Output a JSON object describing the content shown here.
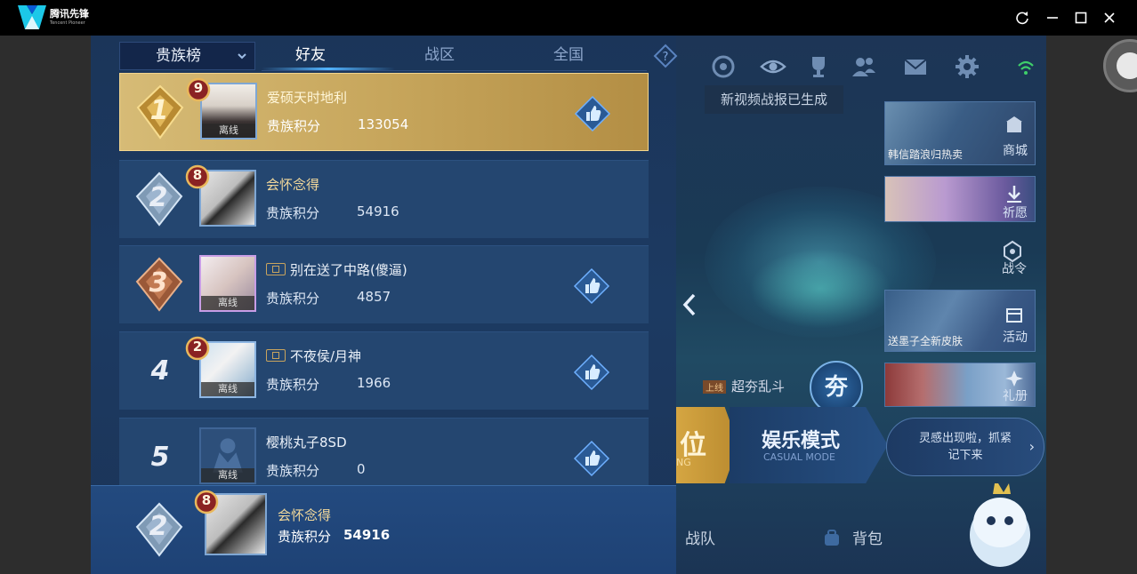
{
  "window": {
    "app_name": "腾讯先锋",
    "app_subtitle": "Tencent Pioneer",
    "controls": [
      "refresh-icon",
      "minimize-icon",
      "maximize-icon",
      "close-icon"
    ]
  },
  "leaderboard": {
    "dropdown_label": "贵族榜",
    "tabs": [
      {
        "label": "好友",
        "active": true
      },
      {
        "label": "战区",
        "active": false
      },
      {
        "label": "全国",
        "active": false
      }
    ],
    "score_label": "贵族积分",
    "rows": [
      {
        "rank": "1",
        "noble_level": "9",
        "name": "爱硕天时地利",
        "score": "133054",
        "status": "离线",
        "has_like": true,
        "has_badge": false
      },
      {
        "rank": "2",
        "noble_level": "8",
        "name": "会怀念得",
        "score": "54916",
        "status": "",
        "has_like": false,
        "has_badge": false
      },
      {
        "rank": "3",
        "noble_level": "",
        "name": "别在送了中路(傻逼)",
        "score": "4857",
        "status": "离线",
        "has_like": true,
        "has_badge": true
      },
      {
        "rank": "4",
        "noble_level": "2",
        "name": "不夜侯/月神",
        "score": "1966",
        "status": "离线",
        "has_like": true,
        "has_badge": true
      },
      {
        "rank": "5",
        "noble_level": "",
        "name": "樱桃丸子8SD",
        "score": "0",
        "status": "离线",
        "has_like": true,
        "has_badge": false
      }
    ],
    "mine": {
      "rank": "2",
      "noble_level": "8",
      "name": "会怀念得",
      "score_label": "贵族积分",
      "score": "54916"
    }
  },
  "game_ui": {
    "video_tip": "新视频战报已生成",
    "side_cards": [
      {
        "label": "商城",
        "caption": "韩信踏浪归热卖"
      },
      {
        "label": "祈愿",
        "caption": ""
      },
      {
        "label": "活动",
        "caption": "送墨子全新皮肤"
      },
      {
        "label": "礼册",
        "caption": ""
      }
    ],
    "battle_pass": "战令",
    "mode_tag_hot": "上线",
    "mode_tag": "超夯乱斗",
    "mode_icon_text": "夯",
    "rank_btn": "位",
    "rank_btn_en": "NG",
    "casual_btn": "娱乐模式",
    "casual_btn_en": "CASUAL MODE",
    "hint_line1": "灵感出现啦，抓紧",
    "hint_line2": "记下来",
    "nav": [
      "战队",
      "背包"
    ]
  },
  "colors": {
    "panel_bg": "#1c3a62",
    "first_row_gold": "#c7a65c",
    "name_gold": "#f3d99b",
    "accent_blue": "#52b4ff"
  }
}
